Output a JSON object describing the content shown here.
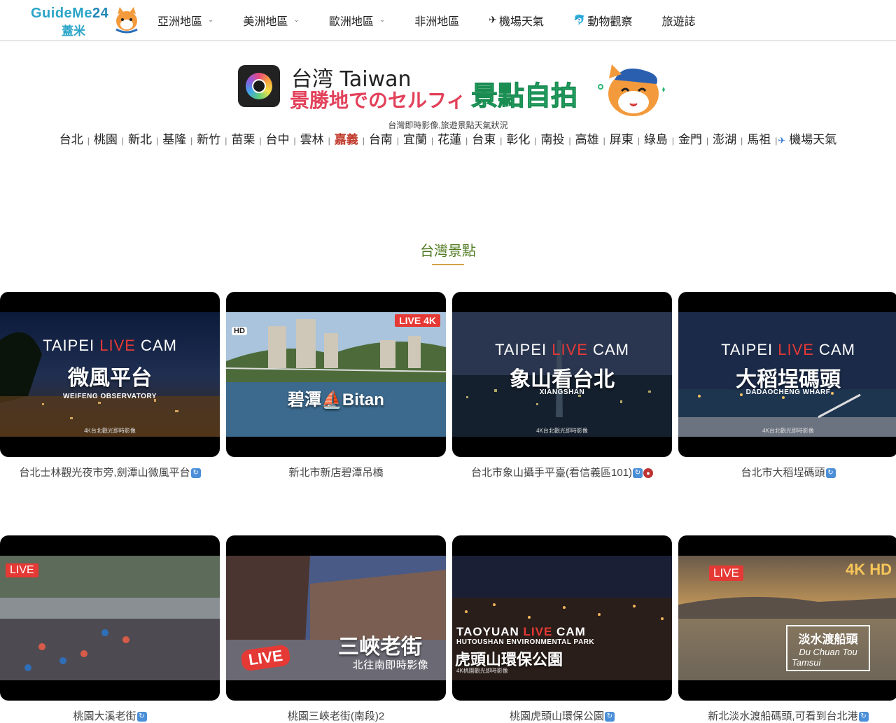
{
  "header": {
    "logo_text": "GuideMe",
    "logo_num": "24",
    "logo_sub": "蓋米",
    "nav": [
      {
        "label": "亞洲地區",
        "dropdown": true,
        "icon": ""
      },
      {
        "label": "美洲地區",
        "dropdown": true,
        "icon": ""
      },
      {
        "label": "歐洲地區",
        "dropdown": true,
        "icon": ""
      },
      {
        "label": "非洲地區",
        "dropdown": false,
        "icon": ""
      },
      {
        "label": "機場天氣",
        "dropdown": false,
        "icon": "✈"
      },
      {
        "label": "動物觀察",
        "dropdown": false,
        "icon": "🐬"
      },
      {
        "label": "旅遊誌",
        "dropdown": false,
        "icon": ""
      }
    ]
  },
  "banner": {
    "line1": "台湾 Taiwan",
    "line2": "景勝地でのセルフィ",
    "big": "景點自拍",
    "subtitle": "台灣即時影像,旅遊景點天氣狀況"
  },
  "cities": [
    "台北",
    "桃園",
    "新北",
    "基隆",
    "新竹",
    "苗栗",
    "台中",
    "雲林",
    "嘉義",
    "台南",
    "宜蘭",
    "花蓮",
    "台東",
    "彰化",
    "南投",
    "高雄",
    "屏東",
    "綠島",
    "金門",
    "澎湖",
    "馬祖",
    "機場天氣"
  ],
  "active_city": "嘉義",
  "section_title": "台灣景點",
  "cards": [
    {
      "l1a": "TAIPEI ",
      "l1b": "LIVE",
      "l1c": " CAM",
      "l2": "微風平台",
      "l3": "WEIFENG OBSERVATORY",
      "l4": "4K台北觀光即時影像",
      "label": "台北士林觀光夜市旁,劍潭山微風平台",
      "badge": "refresh"
    },
    {
      "l2": "碧潭⛵Bitan",
      "live": "LIVE 4K",
      "hd": "HD",
      "label": "新北市新店碧潭吊橋",
      "badge": ""
    },
    {
      "l1a": "TAIPEI ",
      "l1b": "LIVE",
      "l1c": " CAM",
      "l2": "象山看台北",
      "l3": "XIANGSHAN",
      "l4": "4K台北觀光即時影像",
      "label": "台北市象山攝手平臺(看信義區101)",
      "badge": "refresh-rec"
    },
    {
      "l1a": "TAIPEI ",
      "l1b": "LIVE",
      "l1c": " CAM",
      "l2": "大稻埕碼頭",
      "l3": "DADAOCHENG WHARF",
      "l4": "4K台北觀光即時影像",
      "label": "台北市大稻埕碼頭",
      "badge": "refresh"
    },
    {
      "live": "LIVE",
      "label": "桃園大溪老街",
      "badge": "refresh"
    },
    {
      "l2": "三峽老街",
      "l3": "北往南即時影像",
      "live": "LIVE",
      "label": "桃園三峽老街(南段)2",
      "badge": ""
    },
    {
      "l1a": "TAOYUAN ",
      "l1b": "LIVE",
      "l1c": " CAM",
      "l3": "HUTOUSHAN ENVIRONMENTAL PARK",
      "l2": "虎頭山環保公園",
      "l4": "4K桃園觀光即時影像",
      "label": "桃園虎頭山環保公園",
      "badge": "refresh"
    },
    {
      "live": "LIVE",
      "hd": "4K HD",
      "l2": "淡水渡船頭",
      "l3": "Du Chuan Tou",
      "l4": "Tamsui",
      "label": "新北淡水渡船碼頭,可看到台北港",
      "badge": "refresh"
    }
  ],
  "colors": {
    "accent": "#2ba5c8",
    "active_city": "#c0392b",
    "section_title": "#4f7a1f",
    "underline": "#d2a24c",
    "live": "#e53935"
  },
  "icons": {
    "refresh": "refresh-icon",
    "record": "record-icon"
  }
}
